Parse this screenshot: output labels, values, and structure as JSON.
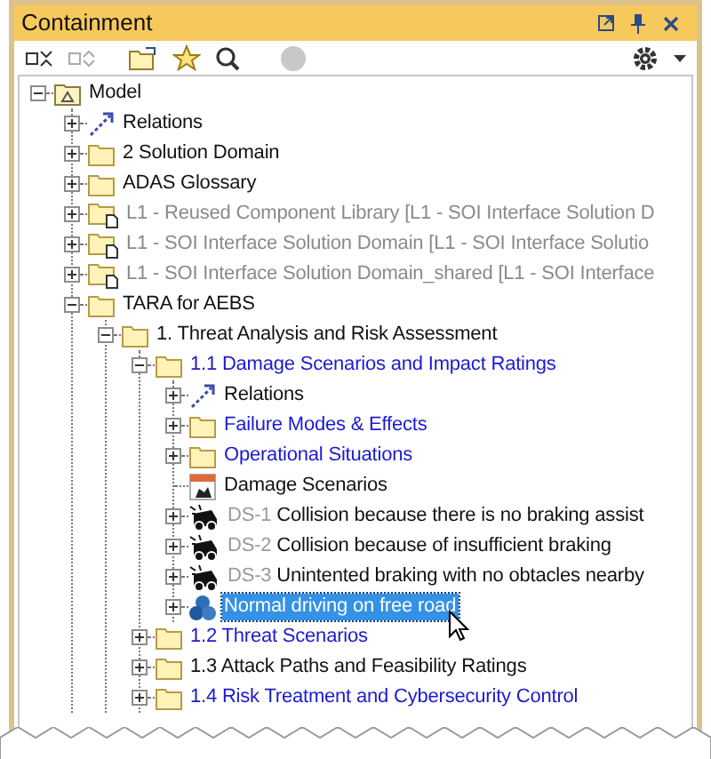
{
  "panel": {
    "title": "Containment"
  },
  "tree": [
    {
      "label": "Model",
      "kind": "model",
      "expanded": true,
      "selected": false,
      "children": [
        {
          "label": "Relations",
          "kind": "relations",
          "expanded": false,
          "selected": false
        },
        {
          "label": "2 Solution Domain",
          "kind": "folder",
          "expanded": false,
          "selected": false
        },
        {
          "label": "ADAS Glossary",
          "kind": "folder",
          "expanded": false,
          "selected": false
        },
        {
          "label": "L1 - Reused Component Library [L1 - SOI Interface Solution D",
          "kind": "library",
          "readonly": true,
          "expanded": false,
          "selected": false
        },
        {
          "label": "L1 - SOI Interface Solution Domain [L1 - SOI Interface Solutio",
          "kind": "library",
          "readonly": true,
          "expanded": false,
          "selected": false
        },
        {
          "label": "L1 - SOI Interface Solution Domain_shared [L1 - SOI Interface",
          "kind": "library",
          "readonly": true,
          "expanded": false,
          "selected": false
        },
        {
          "label": "TARA for AEBS",
          "kind": "folder",
          "expanded": true,
          "selected": false,
          "children": [
            {
              "label": "1. Threat Analysis and Risk Assessment",
              "kind": "folder",
              "expanded": true,
              "selected": false,
              "children": [
                {
                  "label": "1.1 Damage Scenarios and Impact Ratings",
                  "kind": "folder",
                  "linked": true,
                  "expanded": true,
                  "selected": false,
                  "children": [
                    {
                      "label": "Relations",
                      "kind": "relations",
                      "expanded": false,
                      "selected": false
                    },
                    {
                      "label": "Failure Modes & Effects",
                      "kind": "folder",
                      "linked": true,
                      "expanded": false,
                      "selected": false
                    },
                    {
                      "label": "Operational Situations",
                      "kind": "folder",
                      "linked": true,
                      "expanded": false,
                      "selected": false
                    },
                    {
                      "label": "Damage Scenarios",
                      "kind": "diagram",
                      "selected": false
                    },
                    {
                      "prefix": "DS-1",
                      "label": "Collision because there is no braking assist",
                      "kind": "damage",
                      "expanded": false,
                      "selected": false
                    },
                    {
                      "prefix": "DS-2",
                      "label": "Collision because of insufficient braking",
                      "kind": "damage",
                      "expanded": false,
                      "selected": false
                    },
                    {
                      "prefix": "DS-3",
                      "label": "Unintented braking with no obtacles nearby",
                      "kind": "damage",
                      "expanded": false,
                      "selected": false
                    },
                    {
                      "label": "Normal driving on free road",
                      "kind": "situation",
                      "expanded": false,
                      "selected": true
                    }
                  ]
                },
                {
                  "label": "1.2 Threat Scenarios",
                  "kind": "folder",
                  "linked": true,
                  "expanded": false,
                  "selected": false
                },
                {
                  "label": "1.3 Attack Paths and Feasibility Ratings",
                  "kind": "folder",
                  "expanded": false,
                  "selected": false
                },
                {
                  "label": "1.4 Risk Treatment and Cybersecurity Control",
                  "kind": "folder",
                  "linked": true,
                  "expanded": false,
                  "selected": false
                }
              ]
            }
          ]
        }
      ]
    }
  ]
}
